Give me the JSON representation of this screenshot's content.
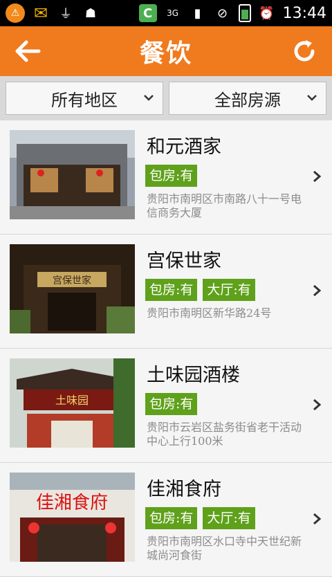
{
  "status_bar": {
    "time": "13:44",
    "icons": [
      "notification-icon",
      "mail-icon",
      "usb-icon",
      "android-icon",
      "c-app-icon",
      "3g-signal-icon",
      "signal-bars-icon",
      "no-sim-icon",
      "battery-icon",
      "alarm-icon"
    ]
  },
  "header": {
    "title": "餐饮",
    "back_icon": "back-arrow-icon",
    "refresh_icon": "refresh-icon",
    "color": "#f07a1e"
  },
  "filters": {
    "region": "所有地区",
    "source": "全部房源"
  },
  "list": [
    {
      "name": "和元酒家",
      "tags": [
        "包房:有"
      ],
      "address": "贵阳市南明区市南路八十一号电信商务大厦"
    },
    {
      "name": "宫保世家",
      "tags": [
        "包房:有",
        "大厅:有"
      ],
      "address": "贵阳市南明区新华路24号"
    },
    {
      "name": "土味园酒楼",
      "tags": [
        "包房:有"
      ],
      "address": "贵阳市云岩区盐务街省老干活动中心上行100米"
    },
    {
      "name": "佳湘食府",
      "tags": [
        "包房:有",
        "大厅:有"
      ],
      "address": "贵阳市南明区水口寺中天世纪新城尚河食街"
    }
  ],
  "thumb_signs": [
    "",
    "宫保世家",
    "土味园",
    "佳湘食府"
  ],
  "tag_color": "#5fa11b"
}
